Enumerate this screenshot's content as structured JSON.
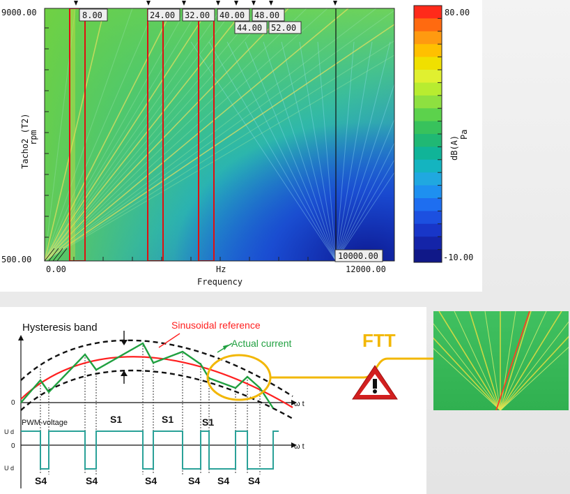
{
  "campbell": {
    "y_axis": {
      "title": "Tacho2 (T2)",
      "unit": "rpm",
      "max_label": "9000.00",
      "min_label": "500.00"
    },
    "x_axis": {
      "title": "Frequency",
      "unit": "Hz",
      "min_label": "0.00",
      "max_label": "12000.00"
    },
    "order_labels": [
      "8.00",
      "24.00",
      "32.00",
      "40.00",
      "48.00",
      "44.00",
      "52.00"
    ],
    "cursor_label": "10000.00",
    "colorbar": {
      "max_label": "80.00",
      "min_label": "-10.00",
      "unit_db": "dB(A)",
      "unit_pa": "Pa",
      "colors": [
        "#ff2a1a",
        "#ff6a10",
        "#ff9a10",
        "#ffc000",
        "#f0e000",
        "#e0f030",
        "#b8ec30",
        "#8ee040",
        "#5cd24c",
        "#38c25c",
        "#20b874",
        "#10b498",
        "#14b4c0",
        "#20a8e0",
        "#1e90f0",
        "#1e6ef0",
        "#1c50e0",
        "#1836c8",
        "#1424a8",
        "#101888"
      ]
    }
  },
  "hysteresis": {
    "band_label": "Hysteresis band",
    "reference_label": "Sinusoidal reference",
    "current_label": "Actual current",
    "pwm_label": "PWM-voltage",
    "s1_labels": [
      "S1",
      "S1",
      "S1"
    ],
    "s4_labels": [
      "S4",
      "S4",
      "S4",
      "S4",
      "S4",
      "S4"
    ],
    "omega_t": "ω t",
    "origin": "0",
    "pwm_zero": "0",
    "ud_top": "U d",
    "ud_bottom": "U d"
  },
  "callout": {
    "text": "FTT",
    "warning_icon": "warning-triangle-icon",
    "color": "#f2b705"
  },
  "colors": {
    "reference": "#ff2020",
    "current": "#20a040",
    "band": "#111111",
    "pwm": "#2aa198",
    "highlight_box": "#e01010"
  }
}
